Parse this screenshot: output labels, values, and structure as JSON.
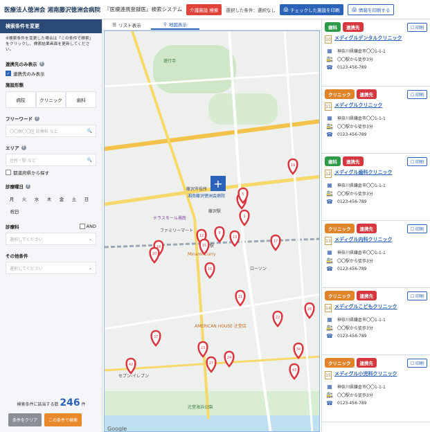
{
  "header": {
    "title": "医療法人徳洲会 湘南藤沢徳洲会病院",
    "subtitle": "『医療連携登録医』検索システム",
    "filter_button": "介護施設 検索",
    "condition_text": "選択した条件：選択なし",
    "print_checked_button": "チェックした施設を印刷",
    "print_info_button": "情報を印刷する"
  },
  "sidebar": {
    "heading": "検索条件を変更",
    "note": "※検索条件を変更した場合は「この条件で検索」をクリックし、検索結果画面を更新してください。",
    "partner_label": "連携先のみ表示",
    "partner_checkbox": "連携先のみ表示",
    "type_label": "施設形態",
    "types": [
      "病院",
      "クリニック",
      "歯科"
    ],
    "freeword_label": "フリーワード",
    "freeword_placeholder": "〇〇病〇〇区 診療科 など",
    "area_label": "エリア",
    "area_placeholder": "住所・駅 など",
    "pref_checkbox": "都道府県から探す",
    "days_label": "診療曜日",
    "days": [
      "月",
      "火",
      "水",
      "木",
      "金",
      "土",
      "日",
      "祝日"
    ],
    "dept_label": "診療科",
    "and_label": "AND",
    "dept_placeholder": "選択してください",
    "other_label": "その他条件",
    "other_placeholder": "選択してください",
    "count_prefix": "検索条件に該当する数",
    "count_value": "246",
    "count_suffix": "件",
    "clear_button": "条件をクリア",
    "search_button": "この条件で検索"
  },
  "tabs": {
    "list": "リスト表示",
    "map": "地図表示"
  },
  "map": {
    "google_label": "Google",
    "labels": [
      "遊行寺",
      "藤沢市役所",
      "藤沢駅",
      "湘南藤沢徳洲会病院",
      "辻堂駅",
      "Minami-Curry",
      "テラスモール湘南",
      "ファミリーマート",
      "AMERICAN HOUSE 辻堂店",
      "セブン-イレブン",
      "ローソン",
      "辻堂海浜公園"
    ],
    "pins": [
      "19",
      "3",
      "5",
      "1",
      "12",
      "9",
      "13",
      "15",
      "17",
      "18",
      "20",
      "16",
      "21",
      "26",
      "22",
      "37",
      "23",
      "24",
      "27",
      "42",
      "34",
      "43"
    ]
  },
  "cards": [
    {
      "tags": [
        "歯科",
        "連携先"
      ],
      "num": "10",
      "name": "メディグルデンタルクリニック",
      "address": "神奈川県鎌倉市〇〇1-1-1",
      "access": "〇〇駅から徒歩3分",
      "tel": "0123-456-789"
    },
    {
      "tags": [
        "クリニック",
        "連携先"
      ],
      "num": "11",
      "name": "メディグルクリニック",
      "address": "神奈川県鎌倉市〇〇1-1-1",
      "access": "〇〇駅から徒歩3分",
      "tel": "0123-456-789"
    },
    {
      "tags": [
        "歯科",
        "連携先"
      ],
      "num": "12",
      "name": "メディグル歯科クリニック",
      "address": "神奈川県鎌倉市〇〇1-1-1",
      "access": "〇〇駅から徒歩3分",
      "tel": "0123-456-789"
    },
    {
      "tags": [
        "クリニック",
        "連携先"
      ],
      "num": "13",
      "name": "メディグル内科クリニック",
      "address": "神奈川県鎌倉市〇〇1-1-1",
      "access": "〇〇駅から徒歩3分",
      "tel": "0123-456-789"
    },
    {
      "tags": [
        "クリニック",
        "連携先"
      ],
      "num": "14",
      "name": "メディグルこどもクリニック",
      "address": "神奈川県鎌倉市〇〇1-1-1",
      "access": "〇〇駅から徒歩3分",
      "tel": "0123-456-789"
    },
    {
      "tags": [
        "クリニック",
        "連携先"
      ],
      "num": "15",
      "name": "メディグル小児科クリニック",
      "address": "神奈川県鎌倉市〇〇1-1-1",
      "access": "〇〇駅から徒歩3分",
      "tel": "0123-456-789"
    }
  ],
  "card_print_label": "印刷",
  "colors": {
    "navy": "#2b4a75",
    "blue": "#2b63b8",
    "red": "#d7373f",
    "green": "#2e9a4a",
    "orange": "#e0842a"
  }
}
